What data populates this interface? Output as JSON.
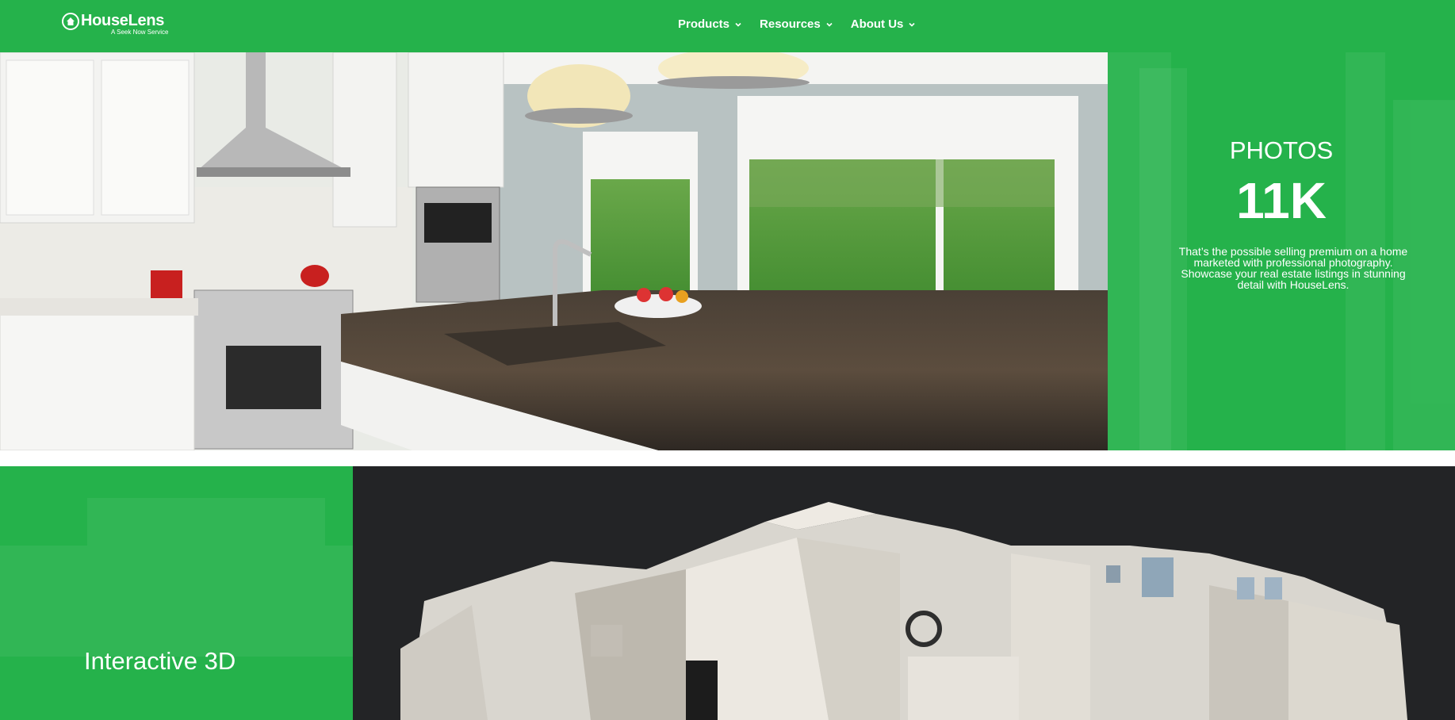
{
  "header": {
    "brand": "HouseLens",
    "tagline": "A Seek Now Service",
    "nav": [
      {
        "label": "Products"
      },
      {
        "label": "Resources"
      },
      {
        "label": "About Us"
      }
    ]
  },
  "photos": {
    "title": "PHOTOS",
    "stat": "11K",
    "description": "That’s the possible selling premium on a home marketed with professional photography. Showcase your real estate listings in stunning detail with HouseLens."
  },
  "interactive": {
    "title": "Interactive 3D"
  },
  "colors": {
    "brand_green": "#25b24b",
    "dark_bg": "#232426"
  }
}
